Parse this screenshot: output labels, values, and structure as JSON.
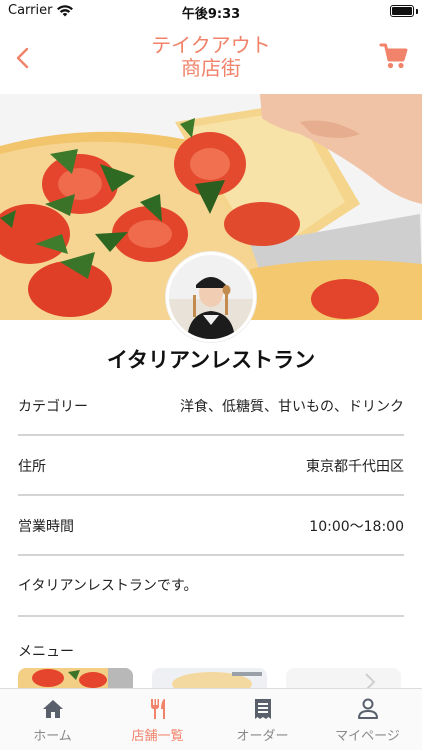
{
  "status_bar": {
    "carrier": "Carrier",
    "time": "午後9:33"
  },
  "nav": {
    "title_line1": "テイクアウト",
    "title_line2": "商店街",
    "back_icon": "chevron-left-icon",
    "cart_icon": "cart-icon"
  },
  "colors": {
    "accent": "#f0836a",
    "tab_inactive": "#8a8a8a",
    "divider": "#d4d4d4"
  },
  "shop": {
    "name": "イタリアンレストラン",
    "rows": [
      {
        "label": "カテゴリー",
        "value": "洋食、低糖質、甘いもの、ドリンク"
      },
      {
        "label": "住所",
        "value": "東京都千代田区"
      },
      {
        "label": "営業時間",
        "value": "10:00〜18:00"
      }
    ],
    "description": "イタリアンレストランです。",
    "menu_label": "メニュー"
  },
  "tabs": [
    {
      "label": "ホーム",
      "icon": "home-icon",
      "active": false
    },
    {
      "label": "店舗一覧",
      "icon": "fork-knife-icon",
      "active": true
    },
    {
      "label": "オーダー",
      "icon": "receipt-icon",
      "active": false
    },
    {
      "label": "マイページ",
      "icon": "person-icon",
      "active": false
    }
  ]
}
